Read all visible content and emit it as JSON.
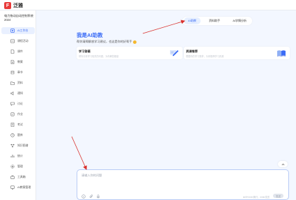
{
  "brand": {
    "mark": "F",
    "name": "泛雅"
  },
  "course": {
    "title": "电力拖动自动控制系统2024"
  },
  "sidebar": {
    "items": [
      {
        "label": "AI工作台",
        "icon": "ai-workbench-icon",
        "active": true
      },
      {
        "label": "课程活动",
        "icon": "activity-icon"
      },
      {
        "label": "课件",
        "icon": "courseware-icon"
      },
      {
        "label": "教案",
        "icon": "lesson-plan-icon"
      },
      {
        "label": "章节",
        "icon": "chapter-icon"
      },
      {
        "label": "资料",
        "icon": "materials-icon"
      },
      {
        "label": "通知",
        "icon": "notice-icon"
      },
      {
        "label": "讨论",
        "icon": "discussion-icon"
      },
      {
        "label": "作业",
        "icon": "homework-icon"
      },
      {
        "label": "考试",
        "icon": "exam-icon"
      },
      {
        "label": "题库",
        "icon": "question-bank-icon"
      },
      {
        "label": "知识图谱",
        "icon": "knowledge-graph-icon"
      },
      {
        "label": "统计",
        "icon": "statistics-icon"
      },
      {
        "label": "管理",
        "icon": "manage-icon"
      },
      {
        "label": "工具箱",
        "icon": "toolbox-icon"
      },
      {
        "label": "AI教案管理",
        "icon": "ai-plan-manage-icon"
      }
    ]
  },
  "tabs": [
    {
      "label": "AI助教",
      "active": true
    },
    {
      "label": "资料助手"
    },
    {
      "label": "AI学情分析"
    }
  ],
  "main": {
    "heading": "我是AI助教",
    "subheading": "帮你清障解惑学习建议，也这是你的好帮手"
  },
  "cards": [
    {
      "title": "学习答疑",
      "desc": "帮你分析学习相关的问题，为你解答疑惑",
      "icon": "pencil-chat-icon"
    },
    {
      "title": "资源推荐",
      "desc": "根据你的学习需求，为你推荐学习资源",
      "icon": "open-book-icon"
    }
  ],
  "composer": {
    "placeholder": "请输入你的问题",
    "hint": "shift+enter换行，enter发送",
    "send_label": "发送"
  },
  "colors": {
    "accent": "#3b6cf6",
    "brand_red": "#e83a3a",
    "annotation": "#d9302c"
  }
}
